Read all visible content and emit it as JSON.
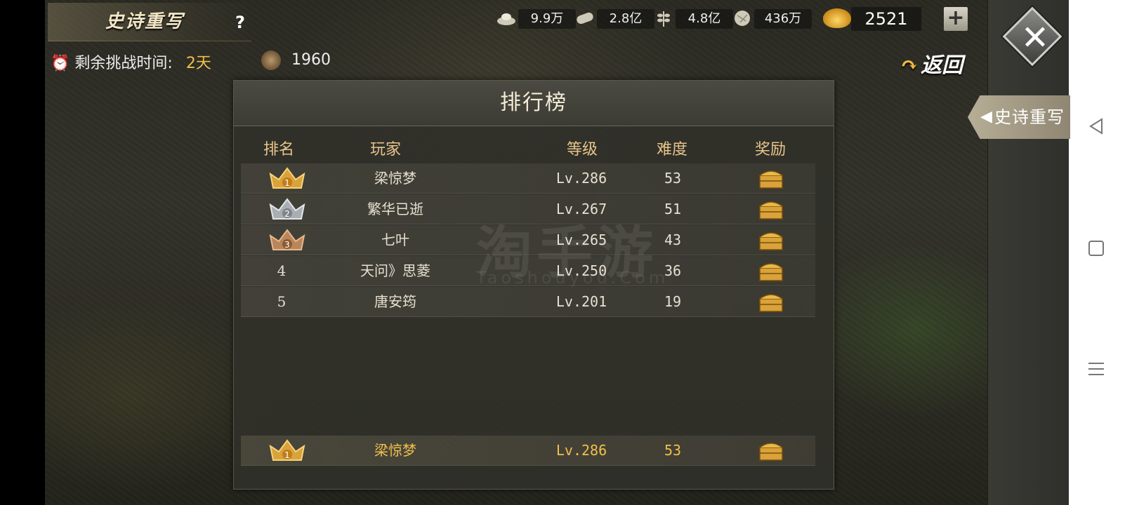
{
  "header": {
    "title": "史诗重写",
    "help_label": "?",
    "timer_label": "剩余挑战时间:",
    "timer_value": "2天",
    "coin_value": "1960",
    "back_label": "返回",
    "side_tab_label": "史诗重写"
  },
  "resources": [
    {
      "icon": "silver-ingot-icon",
      "value": "9.9万"
    },
    {
      "icon": "wood-log-icon",
      "value": "2.8亿"
    },
    {
      "icon": "grain-icon",
      "value": "4.8亿"
    },
    {
      "icon": "stone-icon",
      "value": "436万"
    }
  ],
  "gold": {
    "value": "2521",
    "plus_label": "+"
  },
  "leaderboard": {
    "title": "排行榜",
    "columns": {
      "rank": "排名",
      "player": "玩家",
      "level": "等级",
      "difficulty": "难度",
      "reward": "奖励"
    },
    "rows": [
      {
        "rank": "1",
        "rank_style": "gold-crown",
        "player": "梁惊梦",
        "level": "Lv.286",
        "difficulty": "53"
      },
      {
        "rank": "2",
        "rank_style": "silver-crown",
        "player": "繁华已逝",
        "level": "Lv.267",
        "difficulty": "51"
      },
      {
        "rank": "3",
        "rank_style": "bronze-crown",
        "player": "七叶",
        "level": "Lv.265",
        "difficulty": "43"
      },
      {
        "rank": "4",
        "rank_style": "number",
        "player": "天问》思菱",
        "level": "Lv.250",
        "difficulty": "36"
      },
      {
        "rank": "5",
        "rank_style": "number",
        "player": "唐安筠",
        "level": "Lv.201",
        "difficulty": "19"
      }
    ],
    "my_row": {
      "rank": "1",
      "rank_style": "gold-crown",
      "player": "梁惊梦",
      "level": "Lv.286",
      "difficulty": "53"
    }
  },
  "watermark": {
    "main": "淘手游",
    "sub": "Taoshouyou.Com"
  },
  "colors": {
    "accent_gold": "#f0c04a",
    "header_text": "#e8c58a",
    "panel_bg": "#30302a"
  }
}
